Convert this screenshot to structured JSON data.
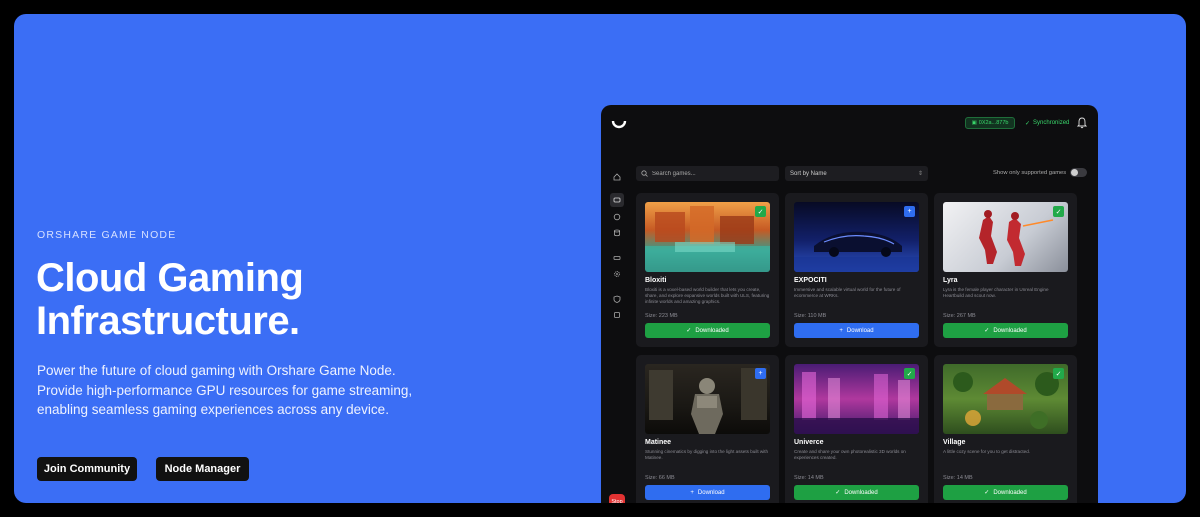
{
  "hero": {
    "eyebrow": "ORSHARE GAME NODE",
    "title": "Cloud Gaming Infrastructure.",
    "description": "Power the future of cloud gaming with Orshare Game Node. Provide high-performance GPU resources for game streaming, enabling seamless gaming experiences across any device.",
    "join_button": "Join Community",
    "node_button": "Node Manager",
    "background_color": "#3b6ef5"
  },
  "app": {
    "wallet": "0X2a...877b",
    "sync_status": "Synchronized",
    "search_placeholder": "Search games...",
    "sort_label": "Sort by Name",
    "toggle_label": "Show only supported games",
    "stop_label": "Stop",
    "games": [
      {
        "name": "Bloxiti",
        "description": "Bloxiti is a voxel-based world builder that lets you create, share, and explore expansive worlds built with ULS, featuring infinite worlds and amazing graphics.",
        "size": "Size: 223 MB",
        "status": "downloaded",
        "button": "Downloaded"
      },
      {
        "name": "EXPOCITI",
        "description": "Immersive and scalable virtual world for the future of ecommerce at WRKs.",
        "size": "Size: 110 MB",
        "status": "download",
        "button": "Download"
      },
      {
        "name": "Lyra",
        "description": "Lyra is the female player character in Unreal Engine Heartbuild and scout now.",
        "size": "Size: 267 MB",
        "status": "downloaded",
        "button": "Downloaded"
      },
      {
        "name": "Matinee",
        "description": "Stunning cinematics by digging into the light assets built with Matinee.",
        "size": "Size: 66 MB",
        "status": "download",
        "button": "Download"
      },
      {
        "name": "Univerce",
        "description": "Create and share your own photorealistic 3D worlds on experiences created.",
        "size": "Size: 14 MB",
        "status": "downloaded",
        "button": "Downloaded"
      },
      {
        "name": "Village",
        "description": "A little cozy scene for you to get distracted.",
        "size": "Size: 14 MB",
        "status": "downloaded",
        "button": "Downloaded"
      }
    ]
  }
}
